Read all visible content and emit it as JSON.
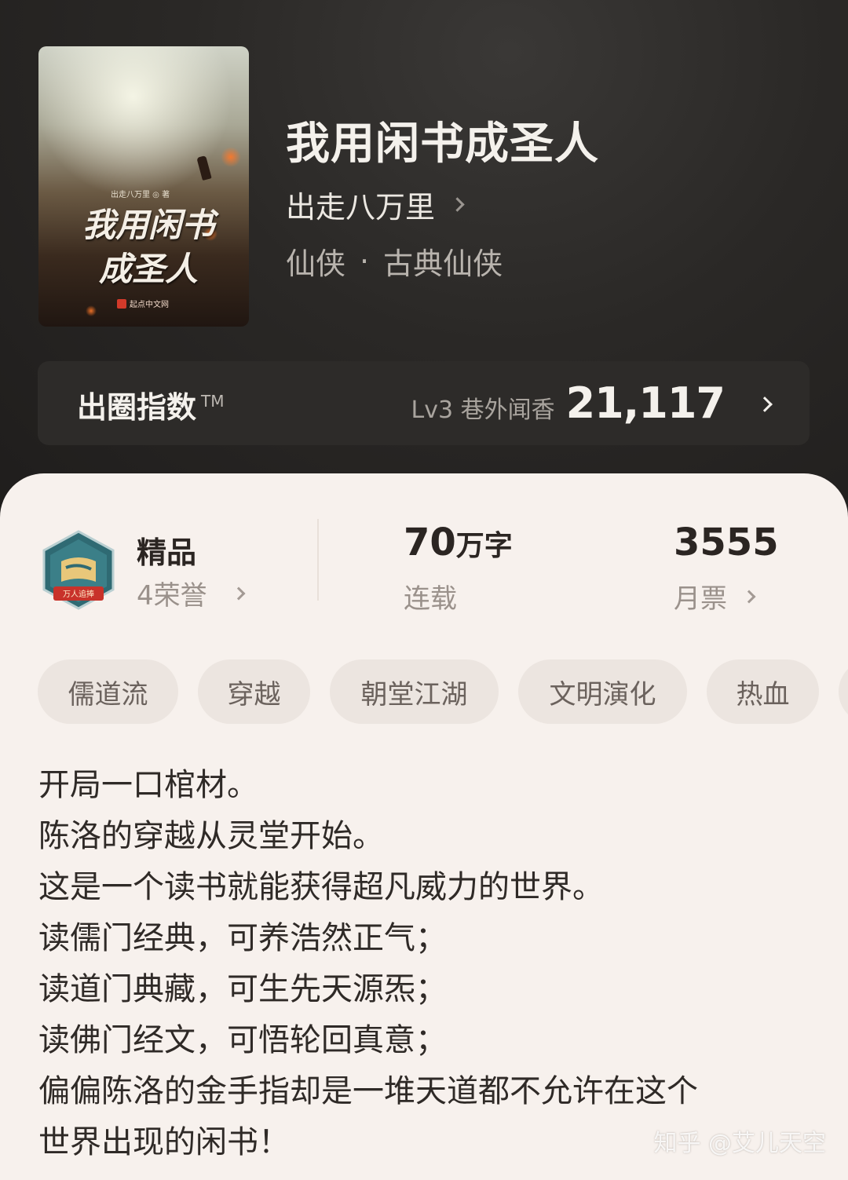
{
  "book": {
    "cover_author": "出走八万里 ◎ 著",
    "cover_title_line1": "我用闲书",
    "cover_title_line2": "成圣人",
    "cover_publisher": "起点中文网",
    "title": "我用闲书成圣人",
    "author": "出走八万里",
    "genre": "仙侠",
    "genre_sep": "·",
    "subgenre": "古典仙侠"
  },
  "index": {
    "label": "出圈指数",
    "tm": "TM",
    "level": "Lv3 巷外闻香",
    "value": "21,117"
  },
  "badge": {
    "ribbon": "万人追捧",
    "name": "精品",
    "honors": "4荣誉"
  },
  "stats": {
    "words_value": "70",
    "words_unit": "万字",
    "words_label": "连载",
    "tickets_value": "3555",
    "tickets_label": "月票"
  },
  "tags": [
    "儒道流",
    "穿越",
    "朝堂江湖",
    "文明演化",
    "热血"
  ],
  "description": [
    "开局一口棺材。",
    "陈洛的穿越从灵堂开始。",
    "这是一个读书就能获得超凡威力的世界。",
    "读儒门经典，可养浩然正气；",
    "读道门典藏，可生先天源炁；",
    "读佛门经文，可悟轮回真意；",
    "偏偏陈洛的金手指却是一堆天道都不允许在这个",
    "世界出现的闲书！"
  ],
  "watermark": "知乎 @艾儿天空"
}
